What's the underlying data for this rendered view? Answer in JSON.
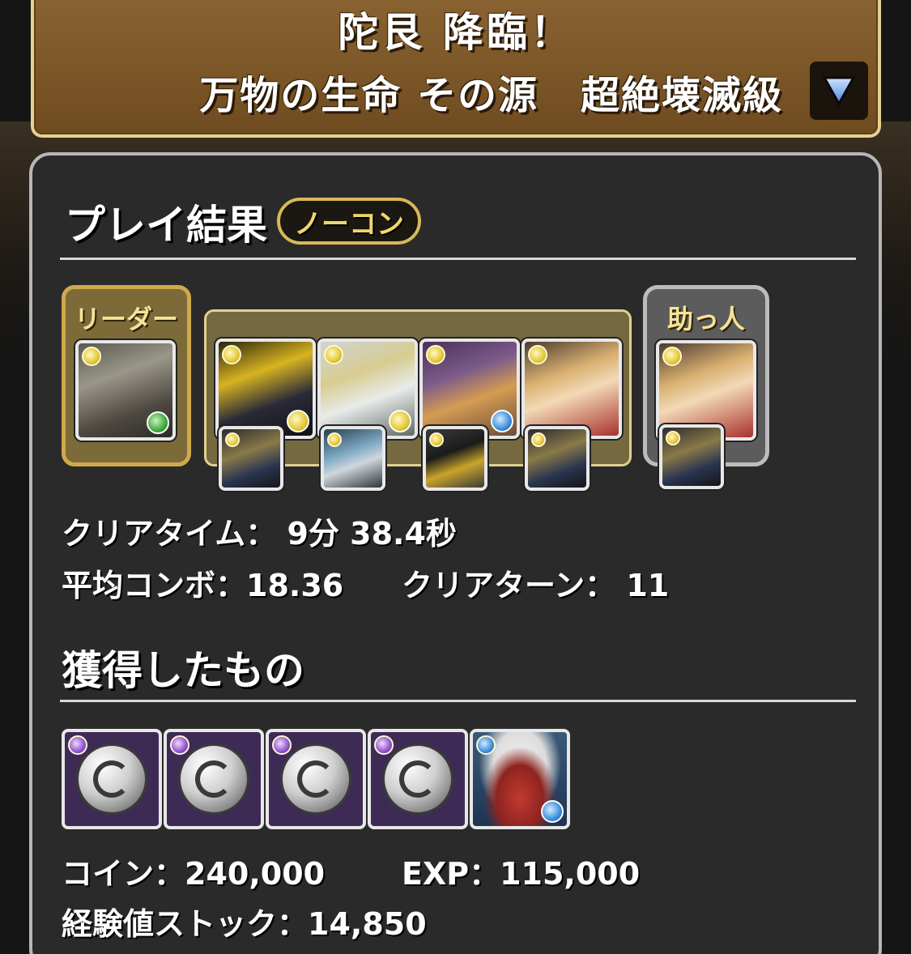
{
  "header": {
    "title": "陀艮 降臨！",
    "subtitle_left": "万物の生命 その源",
    "subtitle_right": "超絶壊滅級",
    "dropdown_icon": "triangle-down-icon"
  },
  "play_result": {
    "title": "プレイ結果",
    "badge": "ノーコン"
  },
  "team": {
    "leader_label": "リーダー",
    "helper_label": "助っ人",
    "members": [
      {
        "role": "leader",
        "attribute": "light",
        "sub_attribute": "wood"
      },
      {
        "role": "sub",
        "attribute": "light",
        "sub_attribute": "light"
      },
      {
        "role": "sub",
        "attribute": "light",
        "sub_attribute": "light"
      },
      {
        "role": "sub",
        "attribute": "light",
        "sub_attribute": "water"
      },
      {
        "role": "sub",
        "attribute": "light",
        "sub_attribute": ""
      },
      {
        "role": "helper",
        "attribute": "light",
        "sub_attribute": ""
      }
    ]
  },
  "stats": {
    "clear_time": "クリアタイム： 9分 38.4秒",
    "avg_combo": "平均コンボ：18.36",
    "clear_turn": "クリアターン： 11"
  },
  "rewards": {
    "title": "獲得したもの",
    "drops": [
      {
        "type": "coin",
        "attribute": "dark"
      },
      {
        "type": "coin",
        "attribute": "dark"
      },
      {
        "type": "coin",
        "attribute": "dark"
      },
      {
        "type": "coin",
        "attribute": "dark"
      },
      {
        "type": "monster",
        "attribute": "water",
        "sub_attribute": "water"
      }
    ],
    "coin": "コイン：240,000",
    "exp": "EXP：115,000",
    "exp_stock": "経験値ストック：14,850"
  }
}
